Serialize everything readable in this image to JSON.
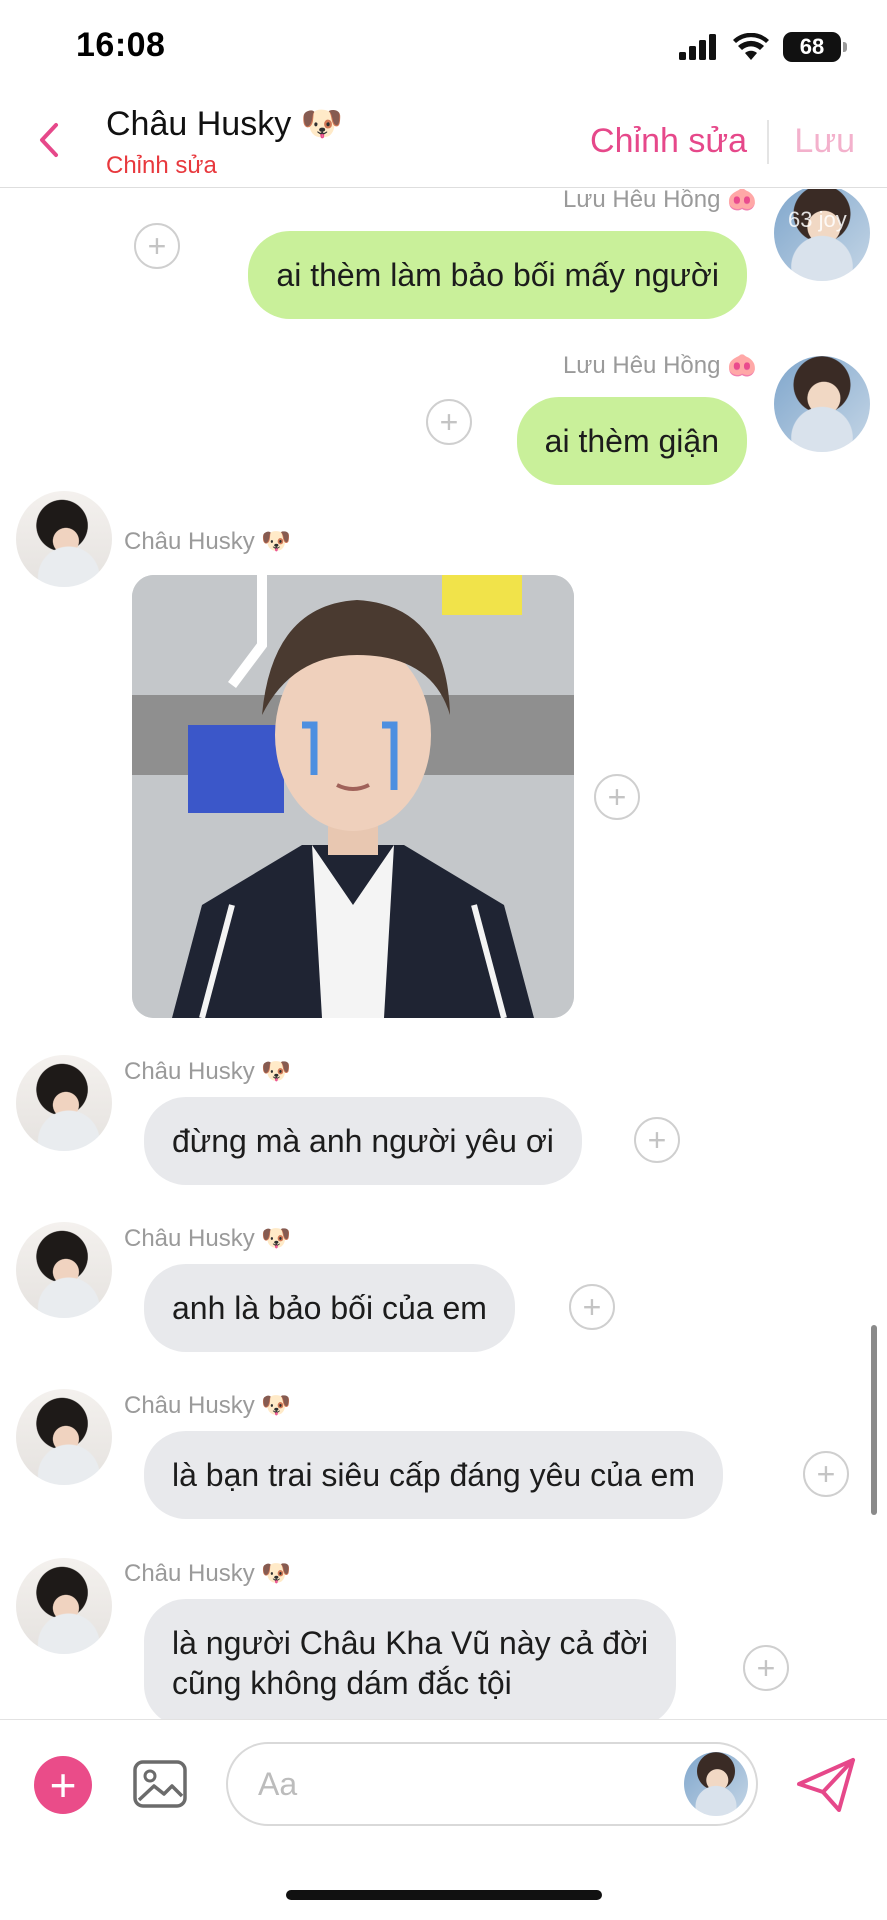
{
  "status": {
    "time": "16:08",
    "battery": "68"
  },
  "header": {
    "title": "Châu Husky 🐶",
    "subtitle": "Chỉnh sửa",
    "edit_label": "Chỉnh sửa",
    "save_label": "Lưu"
  },
  "messages": [
    {
      "sender": "Lưu Hêu Hồng 🐽",
      "text": "ai thèm làm bảo bối mấy người",
      "avatar_overlay": "63 joy"
    },
    {
      "sender": "Lưu Hêu Hồng 🐽",
      "text": "ai thèm giận"
    },
    {
      "sender": "Châu Husky 🐶",
      "type": "image"
    },
    {
      "sender": "Châu Husky 🐶",
      "text": "đừng mà anh người yêu ơi"
    },
    {
      "sender": "Châu Husky 🐶",
      "text": "anh là bảo bối của em"
    },
    {
      "sender": "Châu Husky 🐶",
      "text": "là bạn trai siêu cấp đáng yêu của em"
    },
    {
      "sender": "Châu Husky 🐶",
      "text_lines": [
        "là người Châu Kha Vũ này cả đời",
        "cũng không dám đắc tội"
      ]
    }
  ],
  "input": {
    "placeholder": "Aa"
  },
  "icons": {
    "back": "chevron-left-icon",
    "add": "plus-circle-icon",
    "image": "image-icon",
    "send": "send-icon",
    "react": "plus-icon"
  },
  "colors": {
    "accent": "#e6488a",
    "outgoing_bubble": "#c9f09a",
    "incoming_bubble": "#e8e9ec",
    "subtitle": "#e8383d"
  }
}
